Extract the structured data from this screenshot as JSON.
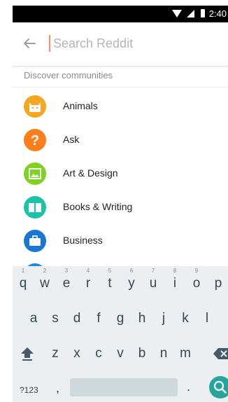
{
  "status_bar": {
    "time": "2:40"
  },
  "search": {
    "placeholder": "Search Reddit",
    "value": ""
  },
  "discover": {
    "title": "Discover communities",
    "items": [
      {
        "label": "Animals",
        "icon": "cat-icon",
        "color": "#f5a623"
      },
      {
        "label": "Ask",
        "icon": "question-icon",
        "color": "#ff7d1a"
      },
      {
        "label": "Art & Design",
        "icon": "picture-icon",
        "color": "#7ed321"
      },
      {
        "label": "Books & Writing",
        "icon": "book-icon",
        "color": "#19c2a9"
      },
      {
        "label": "Business",
        "icon": "briefcase-icon",
        "color": "#1976d2"
      }
    ]
  },
  "keyboard": {
    "row1": [
      {
        "key": "q",
        "hint": "1"
      },
      {
        "key": "w",
        "hint": "2"
      },
      {
        "key": "e",
        "hint": "3"
      },
      {
        "key": "r",
        "hint": "4"
      },
      {
        "key": "t",
        "hint": "5"
      },
      {
        "key": "y",
        "hint": "6"
      },
      {
        "key": "u",
        "hint": "7"
      },
      {
        "key": "i",
        "hint": "8"
      },
      {
        "key": "o",
        "hint": "9"
      },
      {
        "key": "p",
        "hint": ""
      }
    ],
    "row2": [
      "a",
      "s",
      "d",
      "f",
      "g",
      "h",
      "j",
      "k",
      "l"
    ],
    "row3": [
      "z",
      "x",
      "c",
      "v",
      "b",
      "n",
      "m"
    ],
    "symbols_label": "?123",
    "comma": ",",
    "period": "."
  }
}
